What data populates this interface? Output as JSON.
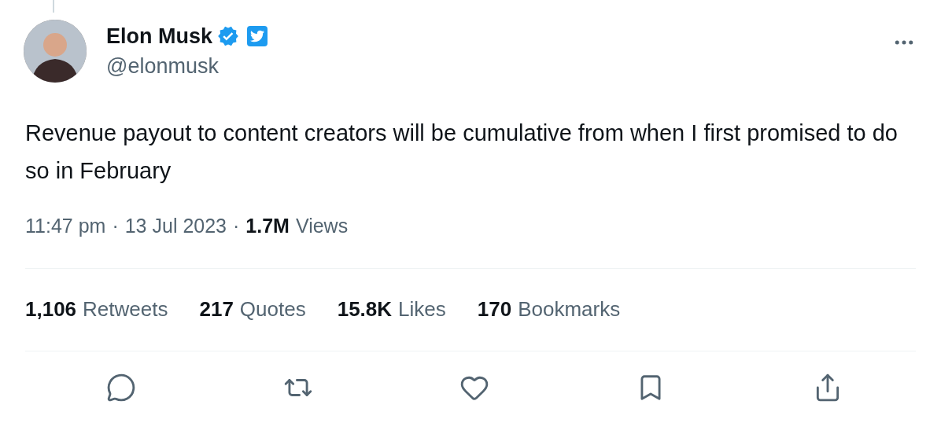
{
  "author": {
    "name": "Elon Musk",
    "handle": "@elonmusk",
    "verified": true,
    "platform_badge": true
  },
  "text": "Revenue payout to content creators will be cumulative from when I first promised to do so in February",
  "meta": [
    "11:47 pm",
    "·",
    "13 Jul 2023",
    "·"
  ],
  "views": {
    "count": "1.7M",
    "label": "Views"
  },
  "stats": [
    {
      "count": "1,106",
      "label": "Retweets"
    },
    {
      "count": "217",
      "label": "Quotes"
    },
    {
      "count": "15.8K",
      "label": "Likes"
    },
    {
      "count": "170",
      "label": "Bookmarks"
    }
  ],
  "actions": [
    {
      "kind": "reply"
    },
    {
      "kind": "retweet"
    },
    {
      "kind": "like"
    },
    {
      "kind": "bookmark"
    },
    {
      "kind": "share"
    }
  ]
}
